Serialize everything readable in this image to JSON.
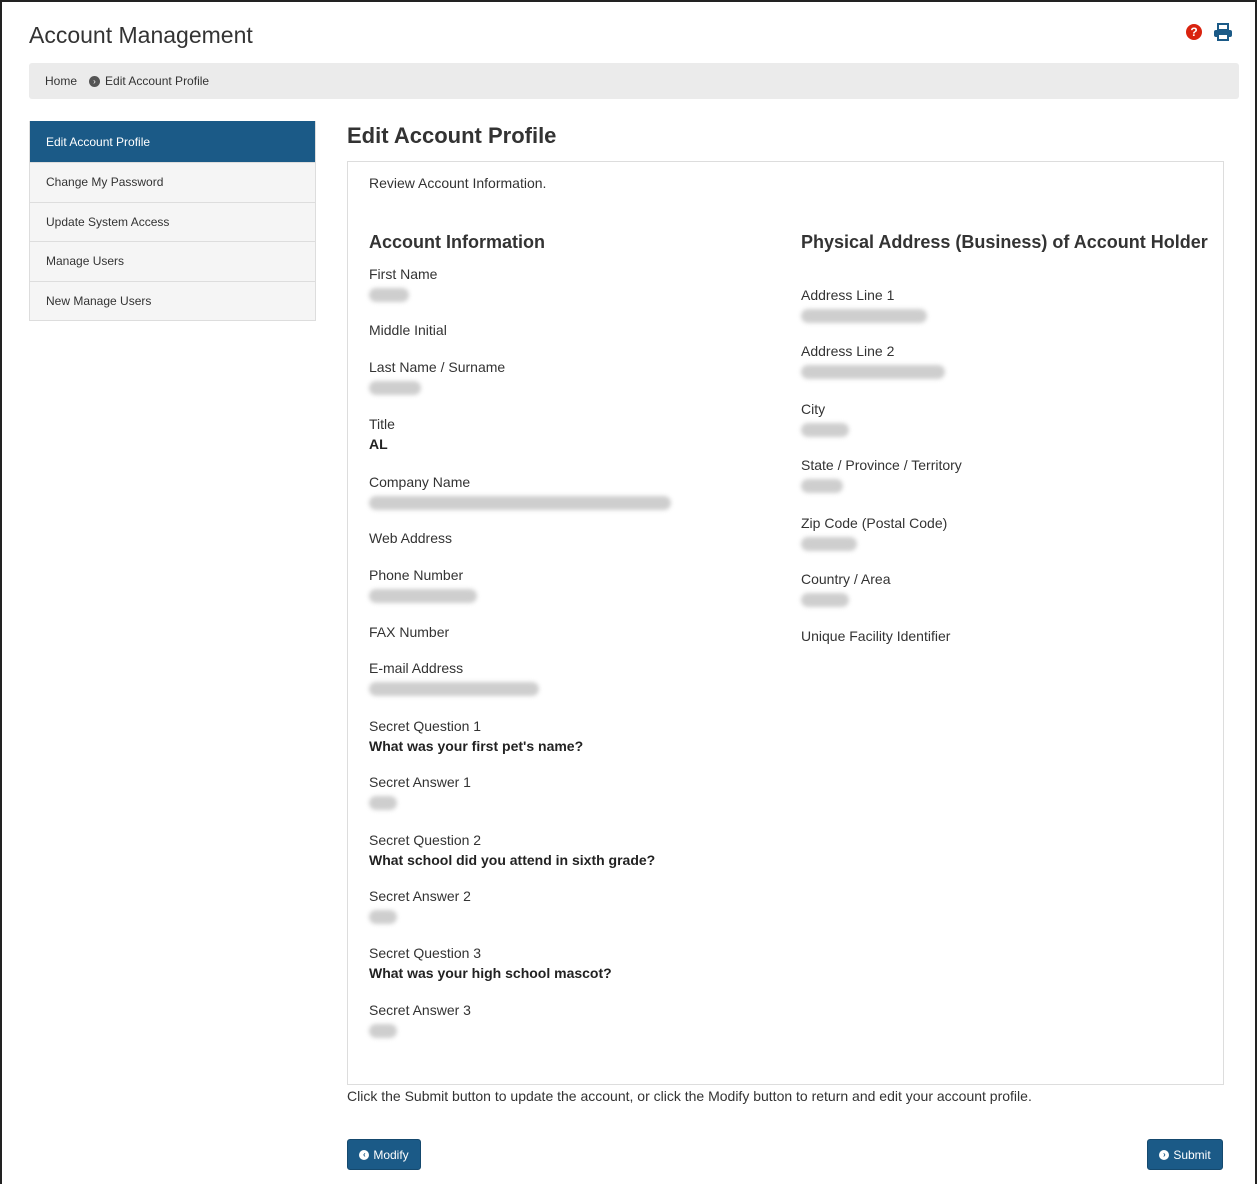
{
  "header": {
    "title": "Account Management"
  },
  "icons": {
    "help": "question-circle-icon",
    "print": "print-icon"
  },
  "breadcrumb": {
    "home": "Home",
    "current": "Edit Account Profile"
  },
  "sidebar": {
    "items": [
      {
        "label": "Edit Account Profile",
        "active": true
      },
      {
        "label": "Change My Password",
        "active": false
      },
      {
        "label": "Update System Access",
        "active": false
      },
      {
        "label": "Manage Users",
        "active": false
      },
      {
        "label": "New Manage Users",
        "active": false
      }
    ]
  },
  "main": {
    "title": "Edit Account Profile",
    "review": "Review Account Information.",
    "account_info": {
      "heading": "Account Information",
      "first_name": {
        "label": "First Name"
      },
      "middle_initial": {
        "label": "Middle Initial"
      },
      "last_name": {
        "label": "Last Name / Surname"
      },
      "title": {
        "label": "Title",
        "value": "AL"
      },
      "company": {
        "label": "Company Name"
      },
      "web": {
        "label": "Web Address"
      },
      "phone": {
        "label": "Phone Number"
      },
      "fax": {
        "label": "FAX Number"
      },
      "email": {
        "label": "E-mail Address"
      },
      "q1": {
        "label": "Secret Question 1",
        "value": "What was your first pet's name?"
      },
      "a1": {
        "label": "Secret Answer 1"
      },
      "q2": {
        "label": "Secret Question 2",
        "value": "What school did you attend in sixth grade?"
      },
      "a2": {
        "label": "Secret Answer 2"
      },
      "q3": {
        "label": "Secret Question 3",
        "value": "What was your high school mascot?"
      },
      "a3": {
        "label": "Secret Answer 3"
      }
    },
    "address": {
      "heading": "Physical Address (Business) of Account Holder",
      "line1": {
        "label": "Address Line 1"
      },
      "line2": {
        "label": "Address Line 2"
      },
      "city": {
        "label": "City"
      },
      "state": {
        "label": "State / Province / Territory"
      },
      "zip": {
        "label": "Zip Code (Postal Code)"
      },
      "country": {
        "label": "Country / Area"
      },
      "ufi": {
        "label": "Unique Facility Identifier"
      }
    },
    "footer_text": "Click the Submit button to update the account, or click the Modify button to return and edit your account profile.",
    "buttons": {
      "modify": "Modify",
      "submit": "Submit"
    }
  },
  "colors": {
    "accent": "#1b5a87",
    "help_red": "#d9230f",
    "breadcrumb_bg": "#ebebeb"
  }
}
